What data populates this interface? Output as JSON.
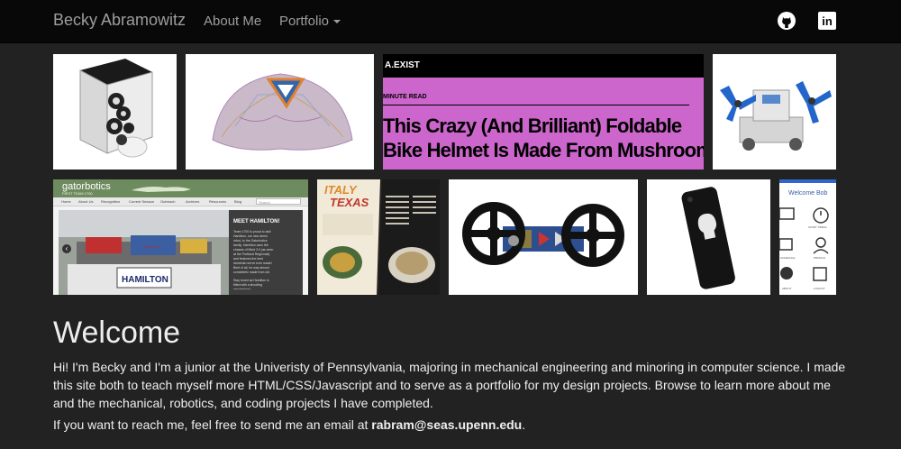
{
  "nav": {
    "brand": "Becky Abramowitz",
    "about": "About Me",
    "portfolio": "Portfolio",
    "github_icon": "github-icon",
    "linkedin_icon": "linkedin-icon",
    "linkedin_text": "in"
  },
  "gallery": {
    "article": {
      "source": "A.EXIST",
      "read_time": "MINUTE READ",
      "headline_line1": "This Crazy (And Brilliant) Foldable",
      "headline_line2": "Bike Helmet Is Made From Mushrooms"
    },
    "gatorbotics": {
      "logo": "gatorbotics",
      "tagline": "FIRST TEAM 1700",
      "menu": [
        "Home",
        "About Us",
        "Recognition",
        "Current Season",
        "Outreach",
        "Archives",
        "Resources",
        "Blog"
      ],
      "search": "Search",
      "card_title": "MEET HAMILTON!",
      "card_text": "Team 1700 is proud to add Hamilton, our new demo robot, to the Gatorbotics family. Hamilton uses the chassis of Mind 3.0 (as seen at the Portland Regionals) and features the best drivetrain we've ever made! Best of all, he was almost completely made from old parts — we saved under $10!",
      "card_text2": "Stay tuned as Hamilton is fitted with a shooting mechanism!",
      "plate": "HAMILTON",
      "plate_small": "California"
    },
    "magazine": {
      "title_line1": "ITALY",
      "title_line2": "TEXAS"
    },
    "app": {
      "welcome": "Welcome Bob",
      "labels": [
        "START TIMING",
        "SCHEDULE",
        "PROFILE",
        "ABOUT",
        "LOGOUT"
      ]
    }
  },
  "welcome": {
    "heading": "Welcome",
    "paragraph1": "Hi! I'm Becky and I'm a junior at the Univeristy of Pennsylvania, majoring in mechanical engineering and minoring in computer science. I made this site both to teach myself more HTML/CSS/Javascript and to serve as a portfolio for my design projects. Browse to learn more about me and the mechanical, robotics, and coding projects I have completed.",
    "paragraph2_prefix": "If you want to reach me, feel free to send me an email at ",
    "email": "rabram@seas.upenn.edu",
    "paragraph2_suffix": "."
  },
  "colors": {
    "navbar": "#080808",
    "background": "#222222",
    "nav_text": "#9d9d9d",
    "article_bg": "#cc66cc",
    "green_header": "#6e8b5f"
  }
}
